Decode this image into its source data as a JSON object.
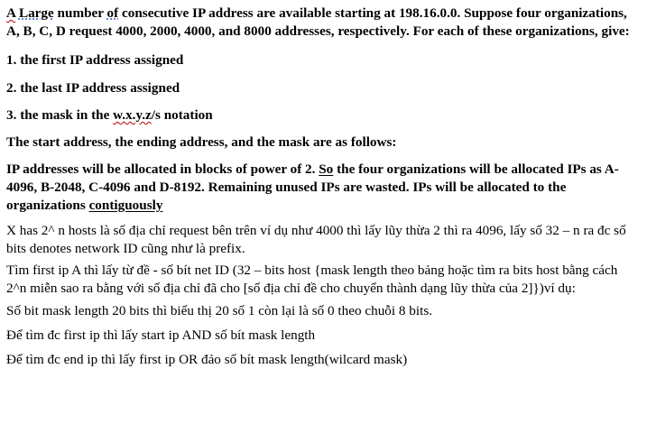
{
  "document": {
    "intro": {
      "w1": "A",
      "w2": "Large",
      "w3": " number ",
      "w4": "of",
      "rest": " consecutive IP address are available starting at 198.16.0.0. Suppose four organizations, A, B, C, D request 4000, 2000, 4000, and 8000 addresses, respectively. For each of these organizations, give:"
    },
    "item1": "1. the first IP address assigned",
    "item2": "2. the last IP address assigned",
    "item3": {
      "before": "3. the mask in the ",
      "notation": "w.x.y.z",
      "after": "/s notation"
    },
    "answer_intro": "The start address, the ending address, and the mask are as follows:",
    "allocation": {
      "before": "IP addresses will be allocated in blocks of power of 2. ",
      "so": "So",
      "middle": " the four organizations will be allocated IPs as A-4096, B-2048, C-4096 and D-8192. Remaining unused IPs are wasted. IPs will be allocated to the organizations ",
      "last": "contiguously"
    },
    "note1": "X has 2^ n hosts là số địa chỉ request bên trên ví dụ như 4000 thì lấy lũy thừa 2 thì ra 4096, lấy số 32 – n ra đc số bits denotes network ID cũng như là prefix.",
    "note2": "Tìm first ip A thì lấy từ đề - số bít net ID (32 – bits host {mask length theo bảng hoặc tìm ra bits host bằng cách 2^n miễn sao ra bằng với số địa chỉ đã cho [số địa chỉ đề cho chuyển thành dạng lũy thừa của 2]})ví dụ:",
    "note3": "Số bit mask length 20 bits thì biểu thị 20 số 1 còn lại là số 0 theo chuỗi 8 bits.",
    "note4": "Để tìm đc first ip thì lấy start ip AND số bít mask length",
    "note5": "Để tìm đc end ip thì lấy first ip OR đảo số bít mask length(wilcard mask)"
  }
}
